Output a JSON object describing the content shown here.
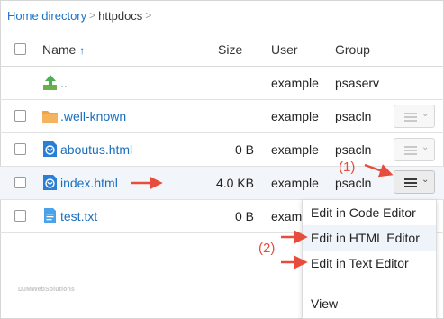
{
  "breadcrumb": {
    "home": "Home directory",
    "current": "httpdocs",
    "separator": ">"
  },
  "table": {
    "columns": {
      "name": "Name",
      "sort_indicator": "↑",
      "size": "Size",
      "user": "User",
      "group": "Group"
    },
    "rows": [
      {
        "name": "..",
        "size": "",
        "user": "example",
        "group": "psaserv",
        "icon": "up-folder-icon"
      },
      {
        "name": ".well-known",
        "size": "",
        "user": "example",
        "group": "psacln",
        "icon": "folder-icon"
      },
      {
        "name": "aboutus.html",
        "size": "0 B",
        "user": "example",
        "group": "psacln",
        "icon": "html-file-icon"
      },
      {
        "name": "index.html",
        "size": "4.0 KB",
        "user": "example",
        "group": "psacln",
        "icon": "html-file-icon"
      },
      {
        "name": "test.txt",
        "size": "0 B",
        "user": "examp",
        "group": "",
        "icon": "text-file-icon"
      }
    ]
  },
  "menu": {
    "items": [
      "Edit in Code Editor",
      "Edit in HTML Editor",
      "Edit in Text Editor",
      "View"
    ]
  },
  "annotations": {
    "step1": "(1)",
    "step2": "(2)"
  },
  "watermark": "DJMWebSolutions",
  "colors": {
    "link": "#1a6fbe",
    "arrow": "#e74c3c",
    "folder": "#f3a24a",
    "up_arrow": "#4caf50"
  }
}
